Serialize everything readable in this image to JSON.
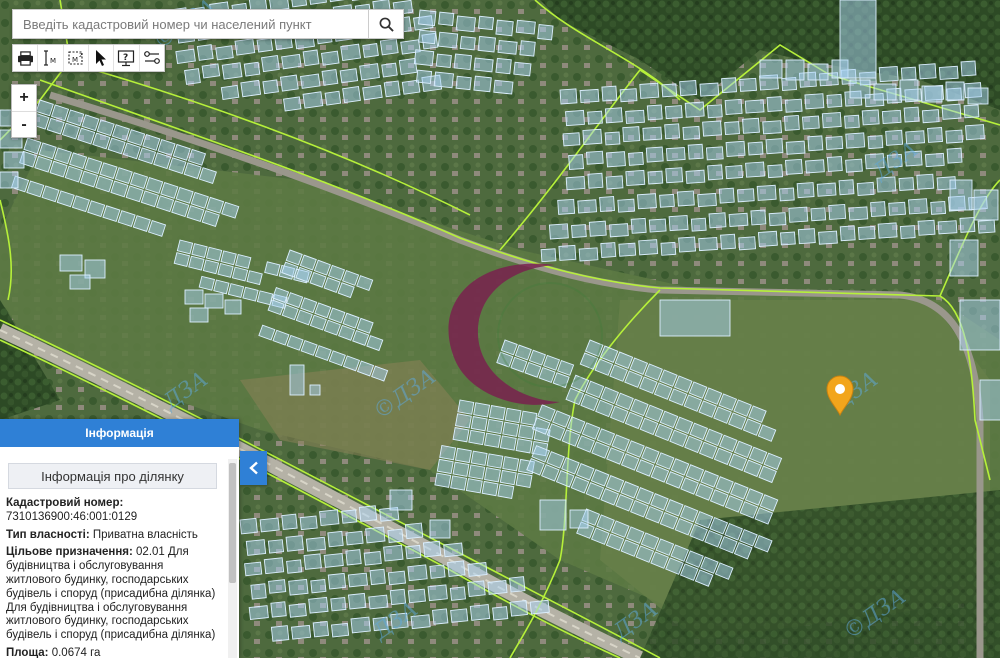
{
  "search": {
    "placeholder": "Введіть кадастровий номер чи населений пункт"
  },
  "toolbar": {
    "tools": [
      "printer-icon",
      "measure-distance-icon",
      "measure-area-icon",
      "cursor-icon",
      "identify-icon",
      "layers-icon"
    ]
  },
  "zoom": {
    "in_label": "+",
    "out_label": "-"
  },
  "panel": {
    "header": "Інформація",
    "subtitle": "Інформація про ділянку",
    "cadastral_label": "Кадастровий номер:",
    "cadastral_value": "7310136900:46:001:0129",
    "ownership_label": "Тип власності:",
    "ownership_value": "Приватна власність",
    "purpose_label": "Цільове призначення:",
    "purpose_value": "02.01 Для будівництва і обслуговування житлового будинку, господарських будівель і споруд (присадибна ділянка) Для будівництва і обслуговування житлового будинку, господарських будівель і споруд (присадибна ділянка)",
    "area_label": "Площа:",
    "area_value": "0.0674 га"
  },
  "map": {
    "watermark_text": "ДЗА",
    "copyright_symbol": "©"
  },
  "colors": {
    "panel_header": "#2f80d6",
    "parcel_fill": "#a9d4f5",
    "parcel_stroke": "#dcefff",
    "boundary_line": "#b6f03a",
    "marker": "#f2a51c"
  }
}
